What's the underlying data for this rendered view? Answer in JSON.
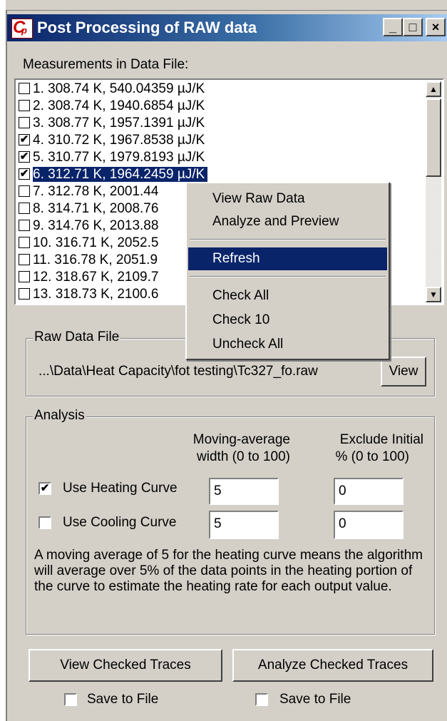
{
  "window": {
    "title": "Post Processing of RAW data",
    "minimize": "_",
    "maximize": "□",
    "close": "×"
  },
  "measurements": {
    "label": "Measurements in Data File:",
    "items": [
      {
        "text": "1. 308.74 K, 540.04359 µJ/K",
        "checked": false
      },
      {
        "text": "2. 308.74 K, 1940.6854 µJ/K",
        "checked": false
      },
      {
        "text": "3. 308.77 K, 1957.1391 µJ/K",
        "checked": false
      },
      {
        "text": "4. 310.72 K, 1967.8538 µJ/K",
        "checked": true
      },
      {
        "text": "5. 310.77 K, 1979.8193 µJ/K",
        "checked": true
      },
      {
        "text": "6. 312.71 K, 1964.2459 µJ/K",
        "checked": true,
        "selected": true
      },
      {
        "text": "7. 312.78 K, 2001.44",
        "checked": false
      },
      {
        "text": "8. 314.71 K, 2008.76",
        "checked": false
      },
      {
        "text": "9. 314.76 K, 2013.88",
        "checked": false
      },
      {
        "text": "10. 316.71 K, 2052.5",
        "checked": false
      },
      {
        "text": "11. 316.78 K, 2051.9",
        "checked": false
      },
      {
        "text": "12. 318.67 K, 2109.7",
        "checked": false
      },
      {
        "text": "13. 318.73 K, 2100.6",
        "checked": false
      }
    ]
  },
  "raw_data_file": {
    "label": "Raw Data File",
    "path": "...\\Data\\Heat Capacity\\fot testing\\Tc327_fo.raw",
    "view_button": "View"
  },
  "analysis": {
    "label": "Analysis",
    "col1_header_line1": "Moving-average",
    "col1_header_line2": "width (0 to 100)",
    "col2_header_line1": "Exclude Initial",
    "col2_header_line2": "% (0 to 100)",
    "heating": {
      "label": "Use Heating Curve",
      "checked": true,
      "width": "5",
      "exclude": "0"
    },
    "cooling": {
      "label": "Use Cooling Curve",
      "checked": false,
      "width": "5",
      "exclude": "0"
    },
    "description": "A moving average of 5 for the heating curve means the algorithm will average over 5% of the data points in the heating portion of the curve to estimate the heating rate for each output value."
  },
  "actions": {
    "view_checked": "View Checked Traces",
    "analyze_checked": "Analyze Checked Traces",
    "save_view": {
      "label": "Save to File",
      "checked": false
    },
    "save_analyze": {
      "label": "Save to File",
      "checked": false
    }
  },
  "context_menu": {
    "view_raw": "View Raw Data",
    "analyze_preview": "Analyze and Preview",
    "refresh": "Refresh",
    "check_all": "Check All",
    "check_10": "Check 10",
    "uncheck_all": "Uncheck All"
  },
  "icons": {
    "app": "cp-logo-icon",
    "check": "checkmark-icon",
    "scroll_up": "arrow-up-icon",
    "scroll_down": "arrow-down-icon"
  },
  "colors": {
    "title_bar": "#0a246a",
    "selection": "#0a246a",
    "window_face": "#d4d0c8",
    "logo_red": "#cc0000"
  }
}
